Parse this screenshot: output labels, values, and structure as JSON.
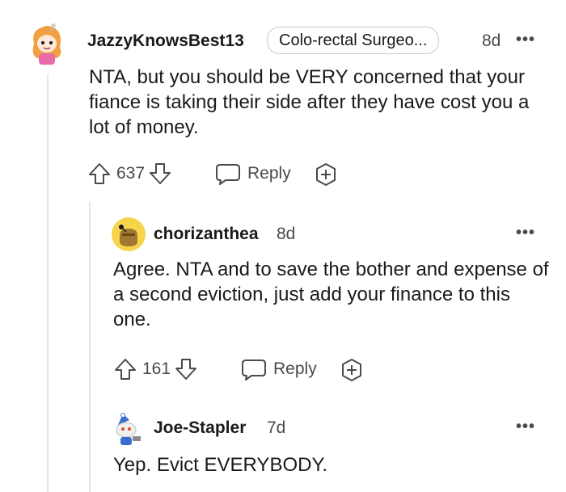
{
  "comments": [
    {
      "username": "JazzyKnowsBest13",
      "flair": "Colo-rectal Surgeo...",
      "time": "8d",
      "more": "•••",
      "body": "NTA, but you should be VERY concerned that your fiance is taking their side after they have cost you a lot of money.",
      "votes": "637",
      "reply_label": "Reply"
    },
    {
      "username": "chorizanthea",
      "time": "8d",
      "more": "•••",
      "body": "Agree. NTA and to save the bother and expense of a second eviction, just add your finance to this one.",
      "votes": "161",
      "reply_label": "Reply"
    },
    {
      "username": "Joe-Stapler",
      "time": "7d",
      "more": "•••",
      "body": "Yep. Evict EVERYBODY."
    }
  ],
  "icons": {
    "upvote": "upvote-arrow-icon",
    "downvote": "downvote-arrow-icon",
    "reply": "speech-bubble-icon",
    "award": "award-plus-icon"
  },
  "colors": {
    "text": "#1a1a1b",
    "muted": "#4a4a4c",
    "thread_line": "#e4e6e8"
  }
}
